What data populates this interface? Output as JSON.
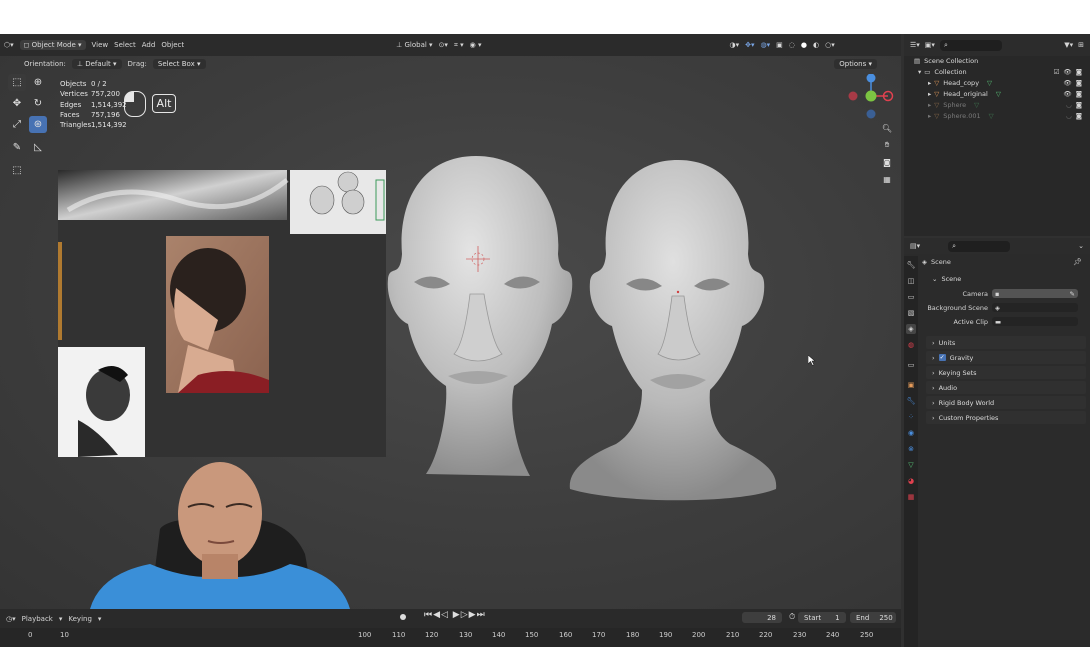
{
  "viewport_header": {
    "editor_icon": "3d-viewport-icon",
    "mode": "Object Mode",
    "menus": [
      "View",
      "Select",
      "Add",
      "Object"
    ],
    "transform_orientation": "Global",
    "options_label": "Options"
  },
  "viewport_subheader": {
    "orientation_label": "Orientation:",
    "orientation_value": "Default",
    "drag_label": "Drag:",
    "drag_value": "Select Box"
  },
  "stats": [
    {
      "label": "Objects",
      "value": "0 / 2"
    },
    {
      "label": "Vertices",
      "value": "757,200"
    },
    {
      "label": "Edges",
      "value": "1,514,392"
    },
    {
      "label": "Faces",
      "value": "757,196"
    },
    {
      "label": "Triangles",
      "value": "1,514,392"
    }
  ],
  "key_overlay": {
    "key": "Alt"
  },
  "timeline": {
    "playback": "Playback",
    "keying": "Keying",
    "current_frame": "28",
    "start_label": "Start",
    "start_value": "1",
    "end_label": "End",
    "end_value": "250",
    "ruler_ticks": [
      "0",
      "10",
      "100",
      "110",
      "120",
      "130",
      "140",
      "150",
      "160",
      "170",
      "180",
      "190",
      "200",
      "210",
      "220",
      "230",
      "240",
      "250"
    ]
  },
  "outliner": {
    "root": "Scene Collection",
    "collection": "Collection",
    "items": [
      {
        "name": "Head_copy",
        "dim": false
      },
      {
        "name": "Head_original",
        "dim": false
      },
      {
        "name": "Sphere",
        "dim": true
      },
      {
        "name": "Sphere.001",
        "dim": true
      }
    ]
  },
  "properties": {
    "context": "Scene",
    "section": "Scene",
    "fields": [
      {
        "label": "Camera",
        "value": ""
      },
      {
        "label": "Background Scene",
        "value": ""
      },
      {
        "label": "Active Clip",
        "value": ""
      }
    ],
    "panels": [
      "Units",
      "Gravity",
      "Keying Sets",
      "Audio",
      "Rigid Body World",
      "Custom Properties"
    ]
  },
  "colors": {
    "accent": "#4772b3",
    "x_axis": "#e0414f",
    "y_axis": "#7cc442",
    "z_axis": "#4a8fe0",
    "viewport_bg": "#3d3d3d"
  }
}
